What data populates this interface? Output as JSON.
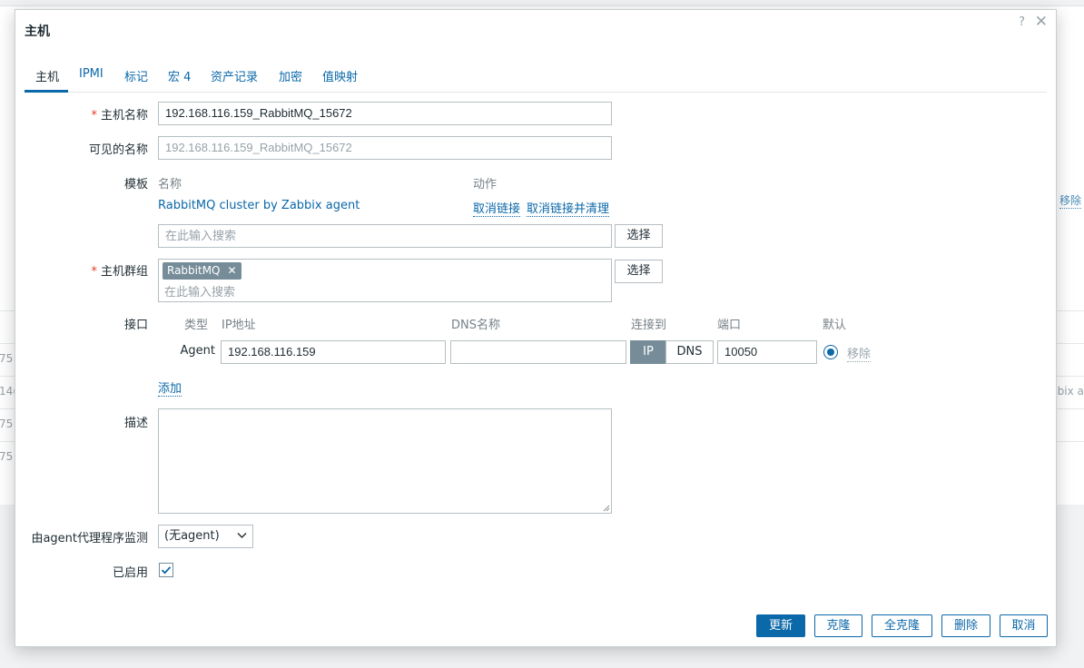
{
  "background": {
    "left_rows": [
      "75",
      "14(",
      "75",
      "75"
    ],
    "right_link": "移除",
    "right_text": "bbix a"
  },
  "dialog": {
    "title": "主机",
    "help_glyph": "?",
    "close_glyph": "✕"
  },
  "tabs": [
    {
      "label": "主机",
      "active": true
    },
    {
      "label": "IPMI"
    },
    {
      "label": "标记"
    },
    {
      "label": "宏 4"
    },
    {
      "label": "资产记录"
    },
    {
      "label": "加密"
    },
    {
      "label": "值映射"
    }
  ],
  "form": {
    "required_mark": "*",
    "hostname": {
      "label": "主机名称",
      "value": "192.168.116.159_RabbitMQ_15672"
    },
    "visible_name": {
      "label": "可见的名称",
      "placeholder": "192.168.116.159_RabbitMQ_15672"
    },
    "templates": {
      "label": "模板",
      "col_name": "名称",
      "col_action": "动作",
      "linked": [
        {
          "name": "RabbitMQ cluster by Zabbix agent",
          "unlink": "取消链接",
          "unlink_clear": "取消链接并清理"
        }
      ],
      "search_placeholder": "在此输入搜索",
      "select_button": "选择"
    },
    "groups": {
      "label": "主机群组",
      "chips": [
        "RabbitMQ"
      ],
      "search_placeholder": "在此输入搜索",
      "select_button": "选择",
      "remove_glyph": "✕"
    },
    "interfaces": {
      "label": "接口",
      "headers": {
        "type": "类型",
        "ip": "IP地址",
        "dns": "DNS名称",
        "connect": "连接到",
        "port": "端口",
        "default": "默认"
      },
      "rows": [
        {
          "type": "Agent",
          "ip": "192.168.116.159",
          "dns": "",
          "connect_options": [
            "IP",
            "DNS"
          ],
          "connect_selected": "IP",
          "port": "10050",
          "remove": "移除"
        }
      ],
      "add": "添加"
    },
    "description": {
      "label": "描述",
      "value": ""
    },
    "proxy": {
      "label": "由agent代理程序监测",
      "selected": "(无agent)"
    },
    "enabled": {
      "label": "已启用",
      "checked": true
    }
  },
  "footer": {
    "update": "更新",
    "clone": "克隆",
    "full_clone": "全克隆",
    "delete": "删除",
    "cancel": "取消"
  },
  "colors": {
    "accent": "#0b68a9",
    "required": "#e03d24",
    "chip": "#768d99"
  },
  "icons": [
    "help-icon",
    "close-icon",
    "chip-remove-icon",
    "chevron-down-icon",
    "checkmark-icon",
    "resize-grip-icon"
  ]
}
